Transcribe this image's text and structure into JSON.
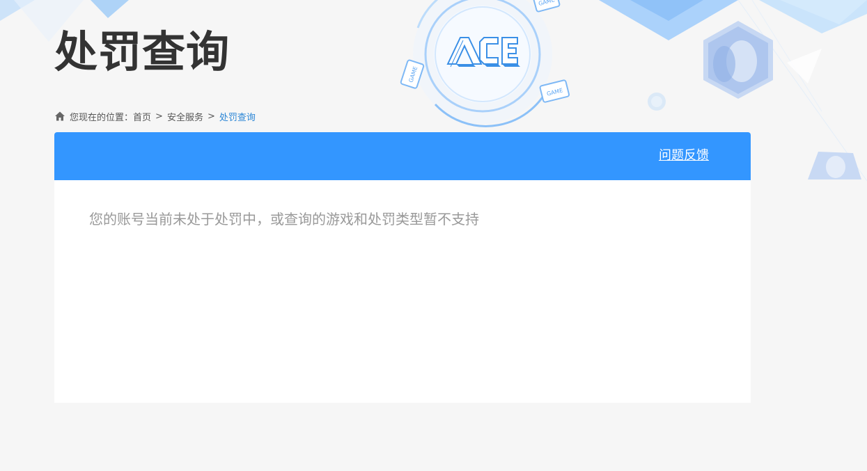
{
  "page": {
    "title": "处罚查询",
    "logo_text": "ACE",
    "badge_text": "GAME"
  },
  "breadcrumb": {
    "prefix": "您现在的位置：",
    "items": [
      "首页",
      "安全服务",
      "处罚查询"
    ],
    "separator": ">"
  },
  "panel": {
    "feedback_label": "问题反馈",
    "message": "您的账号当前未处于处罚中，或查询的游戏和处罚类型暂不支持"
  },
  "colors": {
    "accent": "#3396ff",
    "breadcrumb_current": "#2b86d6",
    "title": "#333333",
    "message": "#999999"
  }
}
